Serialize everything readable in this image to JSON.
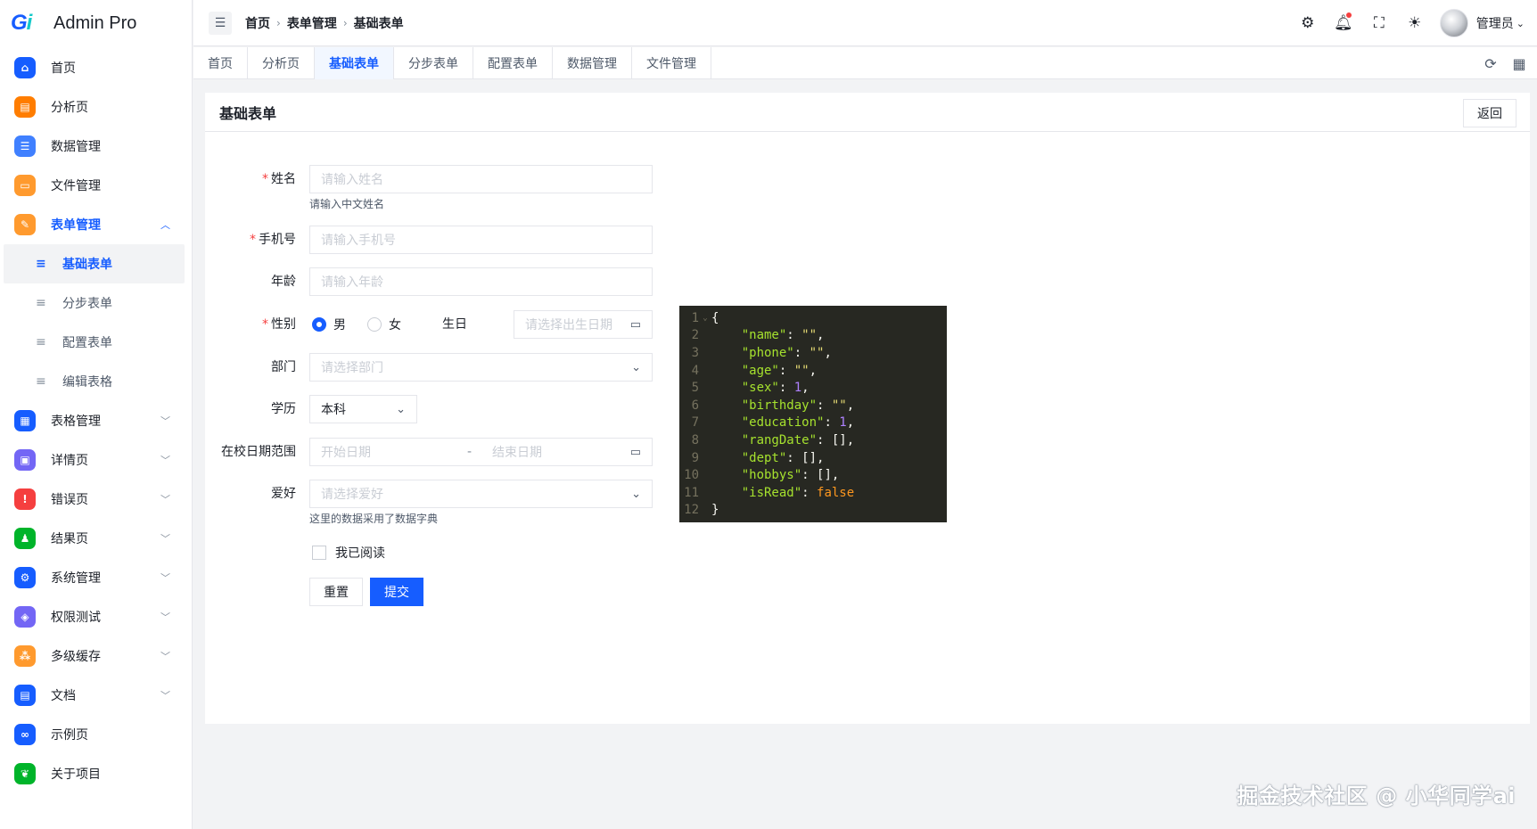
{
  "app": {
    "title": "Admin Pro",
    "logo_text": "Gi"
  },
  "sidebar": {
    "items": [
      {
        "label": "首页",
        "icon": "home-icon",
        "color": "#165dff",
        "glyph": "⌂"
      },
      {
        "label": "分析页",
        "icon": "chart-icon",
        "color": "#ff7d00",
        "glyph": "▤"
      },
      {
        "label": "数据管理",
        "icon": "database-icon",
        "color": "#4080ff",
        "glyph": "☰"
      },
      {
        "label": "文件管理",
        "icon": "folder-icon",
        "color": "#ff9a2e",
        "glyph": "▭"
      },
      {
        "label": "表单管理",
        "icon": "form-icon",
        "color": "#ff9a2e",
        "glyph": "✎"
      }
    ],
    "sub_items": [
      {
        "label": "基础表单",
        "active": true
      },
      {
        "label": "分步表单"
      },
      {
        "label": "配置表单"
      },
      {
        "label": "编辑表格"
      }
    ],
    "items_after": [
      {
        "label": "表格管理",
        "icon": "grid-icon",
        "color": "#165dff",
        "glyph": "▦"
      },
      {
        "label": "详情页",
        "icon": "detail-icon",
        "color": "#7366f5",
        "glyph": "▣"
      },
      {
        "label": "错误页",
        "icon": "error-icon",
        "color": "#f53f3f",
        "glyph": "!"
      },
      {
        "label": "结果页",
        "icon": "user-result-icon",
        "color": "#00b42a",
        "glyph": "♟"
      },
      {
        "label": "系统管理",
        "icon": "settings-icon",
        "color": "#165dff",
        "glyph": "⚙"
      },
      {
        "label": "权限测试",
        "icon": "shield-icon",
        "color": "#7366f5",
        "glyph": "◈"
      },
      {
        "label": "多级缓存",
        "icon": "cache-icon",
        "color": "#ff9a2e",
        "glyph": "⁂"
      },
      {
        "label": "文档",
        "icon": "document-icon",
        "color": "#165dff",
        "glyph": "▤"
      },
      {
        "label": "示例页",
        "icon": "link-icon",
        "color": "#165dff",
        "glyph": "∞"
      },
      {
        "label": "关于项目",
        "icon": "leaf-icon",
        "color": "#00b42a",
        "glyph": "❦"
      }
    ]
  },
  "header": {
    "breadcrumb": [
      "首页",
      "表单管理",
      "基础表单"
    ],
    "username": "管理员"
  },
  "tabs": [
    "首页",
    "分析页",
    "基础表单",
    "分步表单",
    "配置表单",
    "数据管理",
    "文件管理"
  ],
  "card": {
    "title": "基础表单",
    "back_label": "返回"
  },
  "form": {
    "name": {
      "label": "姓名",
      "placeholder": "请输入姓名",
      "help": "请输入中文姓名"
    },
    "phone": {
      "label": "手机号",
      "placeholder": "请输入手机号"
    },
    "age": {
      "label": "年龄",
      "placeholder": "请输入年龄"
    },
    "sex": {
      "label": "性别",
      "options": [
        "男",
        "女"
      ],
      "selected": "男"
    },
    "birthday": {
      "label": "生日",
      "placeholder": "请选择出生日期"
    },
    "dept": {
      "label": "部门",
      "placeholder": "请选择部门"
    },
    "education": {
      "label": "学历",
      "value": "本科"
    },
    "range_date": {
      "label": "在校日期范围",
      "start_placeholder": "开始日期",
      "separator": "-",
      "end_placeholder": "结束日期"
    },
    "hobbys": {
      "label": "爱好",
      "placeholder": "请选择爱好",
      "help": "这里的数据采用了数据字典"
    },
    "is_read": {
      "label": "我已阅读",
      "checked": false
    },
    "reset_label": "重置",
    "submit_label": "提交"
  },
  "code": {
    "lines": [
      {
        "n": "1",
        "text": "{"
      },
      {
        "n": "2",
        "key": "\"name\"",
        "val": "\"\"",
        "vt": "s",
        "comma": ","
      },
      {
        "n": "3",
        "key": "\"phone\"",
        "val": "\"\"",
        "vt": "s",
        "comma": ","
      },
      {
        "n": "4",
        "key": "\"age\"",
        "val": "\"\"",
        "vt": "s",
        "comma": ","
      },
      {
        "n": "5",
        "key": "\"sex\"",
        "val": "1",
        "vt": "n",
        "comma": ","
      },
      {
        "n": "6",
        "key": "\"birthday\"",
        "val": "\"\"",
        "vt": "s",
        "comma": ","
      },
      {
        "n": "7",
        "key": "\"education\"",
        "val": "1",
        "vt": "n",
        "comma": ","
      },
      {
        "n": "8",
        "key": "\"rangDate\"",
        "val": "[]",
        "vt": "t",
        "comma": ","
      },
      {
        "n": "9",
        "key": "\"dept\"",
        "val": "[]",
        "vt": "t",
        "comma": ","
      },
      {
        "n": "10",
        "key": "\"hobbys\"",
        "val": "[]",
        "vt": "t",
        "comma": ","
      },
      {
        "n": "11",
        "key": "\"isRead\"",
        "val": "false",
        "vt": "b",
        "comma": ""
      },
      {
        "n": "12",
        "text": "}"
      }
    ]
  },
  "watermark": "掘金技术社区 @ 小华同学ai",
  "colors": {
    "primary": "#165dff",
    "danger": "#f53f3f",
    "code_bg": "#272822"
  }
}
